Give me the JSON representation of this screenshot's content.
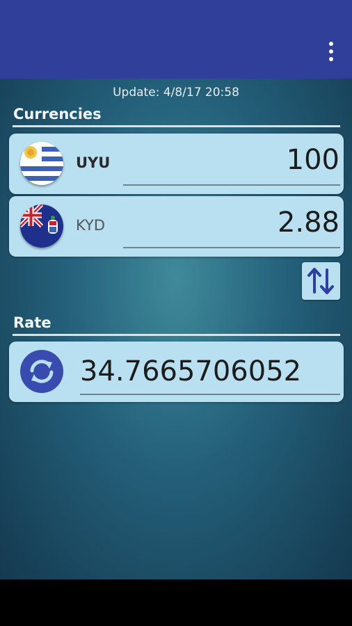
{
  "header": {
    "menu_icon": "overflow-menu-icon"
  },
  "update_text": "Update: 4/8/17 20:58",
  "currencies": {
    "title": "Currencies",
    "items": [
      {
        "code": "UYU",
        "amount": "100",
        "flag": "uruguay-flag-icon"
      },
      {
        "code": "KYD",
        "amount": "2.88",
        "flag": "cayman-islands-flag-icon"
      }
    ],
    "swap_icon": "swap-arrows-icon"
  },
  "rate": {
    "title": "Rate",
    "value": "34.7665706052",
    "icon": "refresh-icon"
  },
  "colors": {
    "appbar": "#30409a",
    "card": "#b8e0f0",
    "accent": "#3a4bb0"
  }
}
